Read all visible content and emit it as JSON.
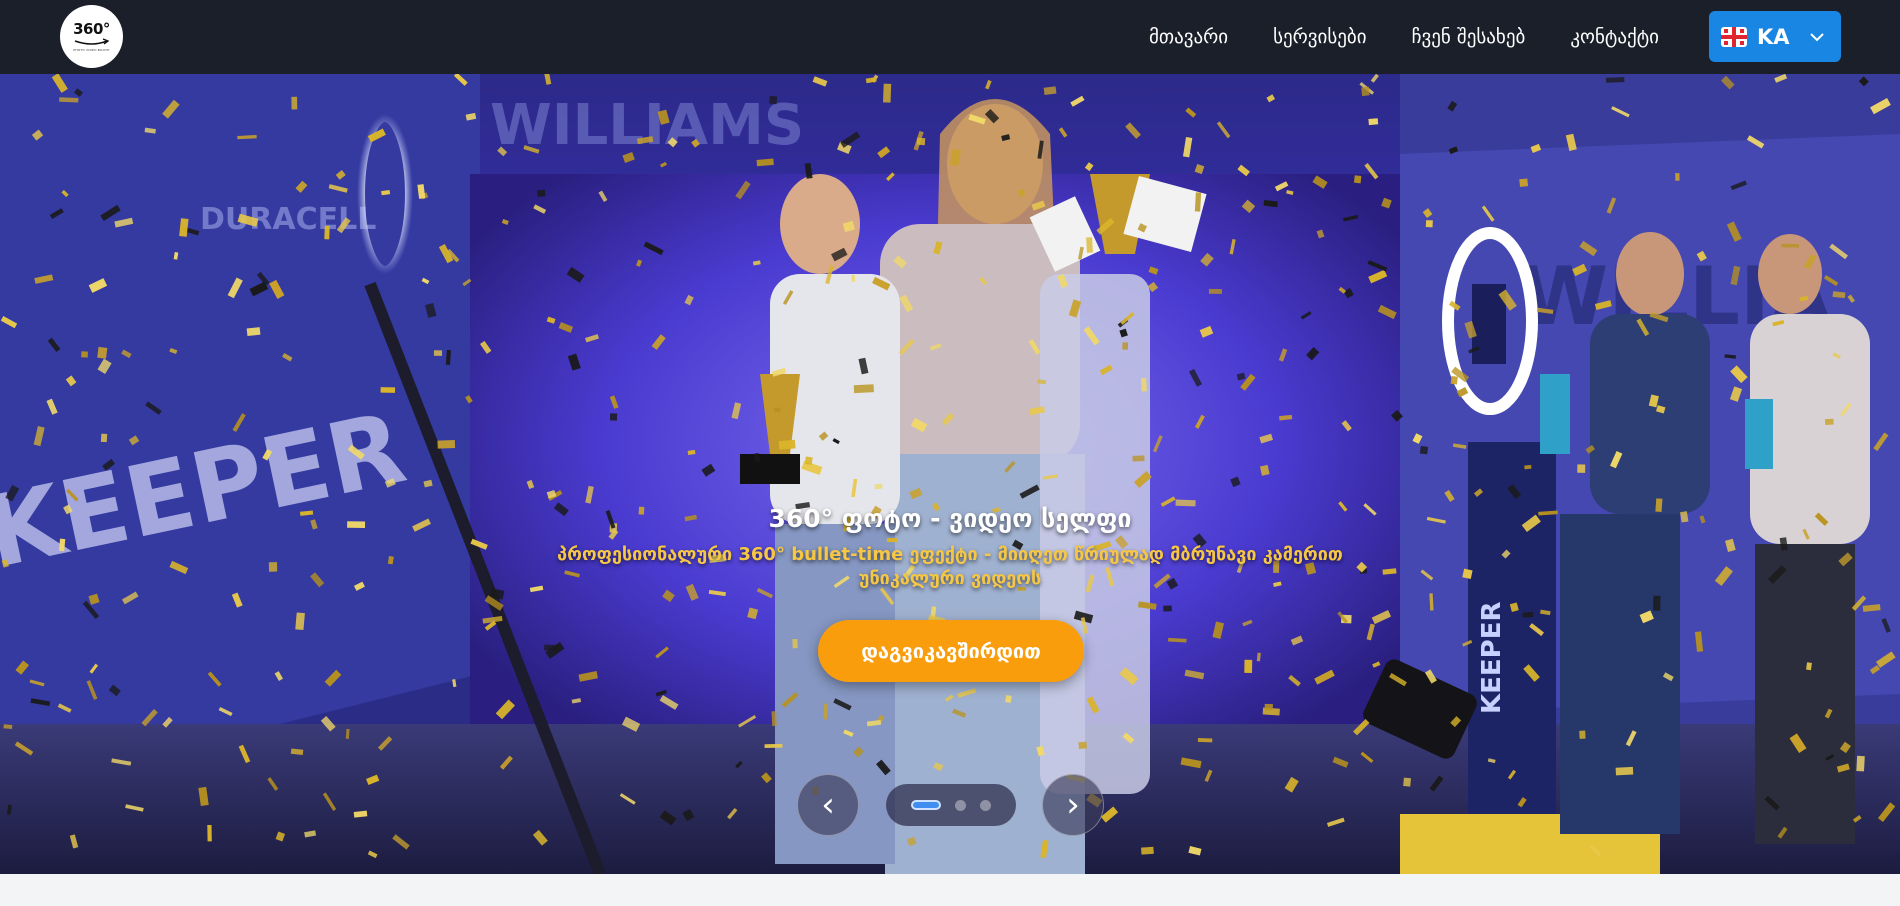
{
  "logo": {
    "text": "360°",
    "subtext": "PHOTO VIDEO BOOTH"
  },
  "nav": {
    "links": [
      {
        "label": "მთავარი"
      },
      {
        "label": "სერვისები"
      },
      {
        "label": "ჩვენ შესახებ"
      },
      {
        "label": "კონტაქტი"
      }
    ],
    "language": {
      "code": "KA",
      "flag_icon": "georgia-flag-icon"
    }
  },
  "hero": {
    "title": "360° ფოტო - ვიდეო სელფი",
    "subtitle": "პროფესიონალური 360° bullet-time ეფექტი - მიიღეთ წრიულად მბრუნავი კამერით უნიკალური ვიდეოს",
    "cta_label": "დაგვიკავშირდით",
    "prev_label": "‹",
    "next_label": "›",
    "slides_total": 3,
    "active_slide": 1,
    "background_texts": {
      "brand_left": "KEEPER",
      "brand_top": "WILLIAMS",
      "sponsor": "DURACELL",
      "brand_right": "WILLIA"
    }
  },
  "colors": {
    "navbar": "#1b1f2a",
    "language_button": "#1a86e3",
    "cta": "#f99d0d",
    "subtitle": "#f6c744",
    "hero_purple": "#3b2fb6",
    "confetti_gold": "#d9b42a"
  }
}
